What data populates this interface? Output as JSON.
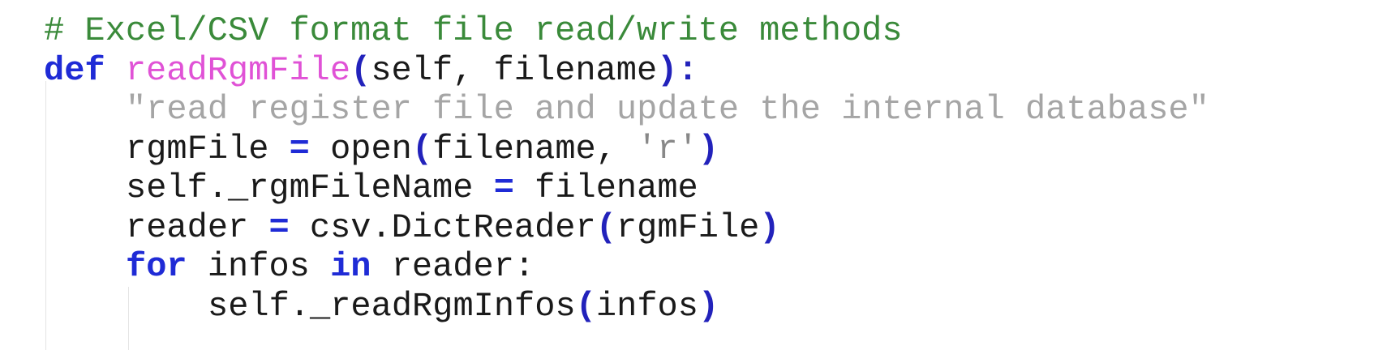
{
  "editor": {
    "lines": {
      "l1": {
        "comment": "# Excel/CSV format file read/write methods"
      },
      "l2": {
        "kw": "def",
        "fname": "readRgmFile",
        "open": "(",
        "args": "self, filename",
        "close": ")",
        "colon": ":"
      },
      "l3": {
        "docstring": "\"read register file and update the internal database\""
      },
      "l4": {
        "lhs": "rgmFile ",
        "eq": "=",
        "rhs_a": " open",
        "open": "(",
        "arg": "filename, ",
        "str": "'r'",
        "close": ")"
      },
      "l5": {
        "lhs": "self._rgmFileName ",
        "eq": "=",
        "rhs": " filename"
      },
      "l6": {
        "lhs": "reader ",
        "eq": "=",
        "rhs_a": " csv.DictReader",
        "open": "(",
        "arg": "rgmFile",
        "close": ")"
      },
      "l7": {
        "kw_for": "for",
        "mid": " infos ",
        "kw_in": "in",
        "rest": " reader:"
      },
      "l8": {
        "call": "self._readRgmInfos",
        "open": "(",
        "arg": "infos",
        "close": ")"
      }
    }
  }
}
